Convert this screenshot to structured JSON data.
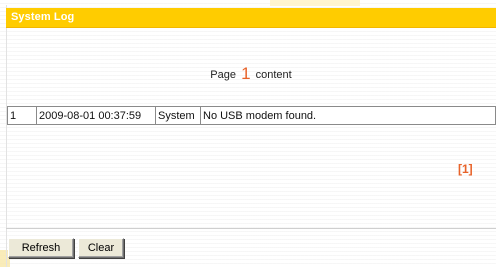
{
  "panel": {
    "title": "System Log"
  },
  "paging": {
    "prefix": "Page",
    "current_page": "1",
    "suffix": "content",
    "page_links": "[1]"
  },
  "log": {
    "rows": [
      {
        "index": "1",
        "time": "2009-08-01 00:37:59",
        "source": "System",
        "message": "No USB modem found."
      }
    ]
  },
  "actions": {
    "refresh_label": "Refresh",
    "clear_label": "Clear"
  },
  "colors": {
    "title_bar": "#ffcc00",
    "title_text": "#ffffff",
    "page_accent": "#e8632a"
  }
}
